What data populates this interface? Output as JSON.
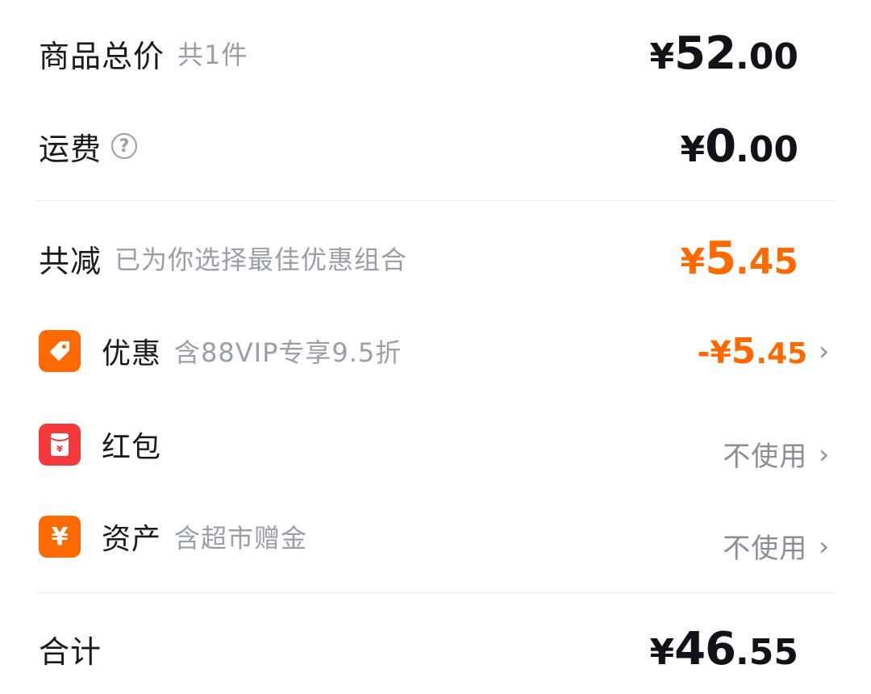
{
  "subtotal": {
    "label": "商品总价",
    "count_text": "共1件",
    "currency": "¥",
    "int": "52",
    "dec": ".00"
  },
  "shipping": {
    "label": "运费",
    "help_glyph": "?",
    "currency": "¥",
    "int": "0",
    "dec": ".00"
  },
  "reduction": {
    "label": "共减",
    "desc": "已为你选择最佳优惠组合",
    "currency": "¥",
    "int": "5",
    "dec": ".45",
    "color": "#ff6a00"
  },
  "items": [
    {
      "label": "优惠",
      "sub": "含88VIP专享9.5折",
      "icon": "tag-icon",
      "icon_color": "#ff6a00",
      "value_sign": "-",
      "value_currency": "¥",
      "value_int": "5",
      "value_dec": ".45"
    },
    {
      "label": "红包",
      "icon": "red-packet-icon",
      "icon_color": "#f5383a",
      "value": "不使用"
    },
    {
      "label": "资产",
      "sub": "含超市赠金",
      "icon": "yen-icon",
      "icon_color": "#ff6a00",
      "value": "不使用"
    }
  ],
  "total": {
    "label": "合计",
    "currency": "¥",
    "int": "46",
    "dec": ".55"
  },
  "chevron_glyph": "›",
  "icon_glyph_yen": "¥"
}
